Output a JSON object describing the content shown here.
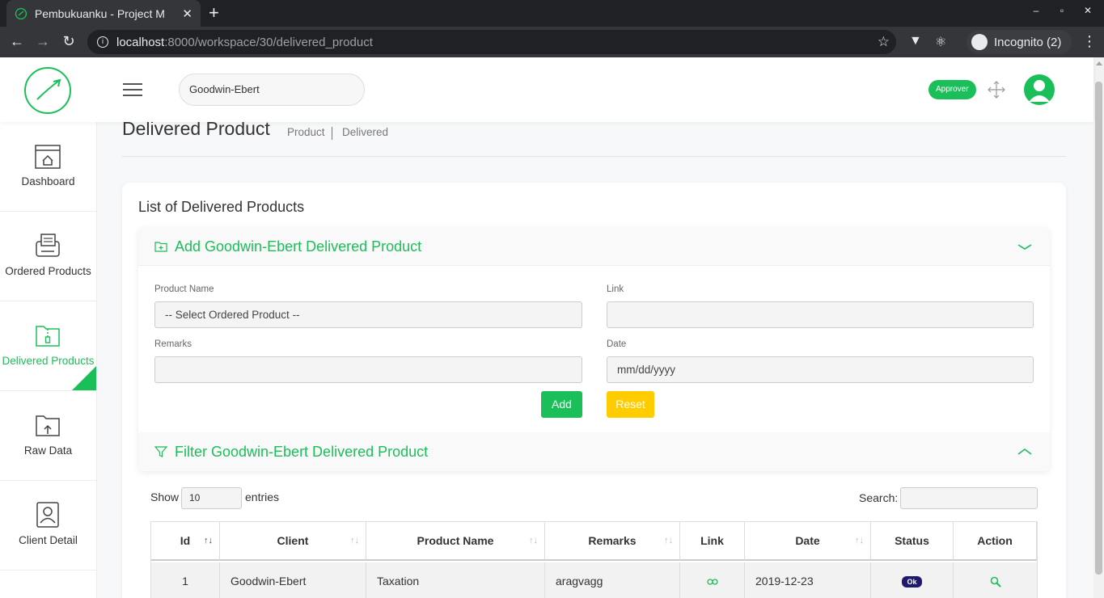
{
  "browser": {
    "tab_title": "Pembukuanku - Project M",
    "tab_close": "✕",
    "new_tab": "+",
    "url_host": "localhost",
    "url_rest": ":8000/workspace/30/delivered_product",
    "incognito_label": "Incognito (2)",
    "window_controls": [
      "‒",
      "▫",
      "✕"
    ]
  },
  "header": {
    "workspace_name": "Goodwin-Ebert",
    "role_badge": "Approver"
  },
  "sidebar": {
    "items": [
      {
        "label": "Dashboard",
        "icon": "dashboard-icon"
      },
      {
        "label": "Ordered Products",
        "icon": "printer-icon"
      },
      {
        "label": "Delivered Products",
        "icon": "zip-folder-icon",
        "active": true
      },
      {
        "label": "Raw Data",
        "icon": "folder-upload-icon"
      },
      {
        "label": "Client Detail",
        "icon": "contact-card-icon"
      }
    ]
  },
  "page": {
    "title": "Delivered Product",
    "breadcrumb_1": "Product",
    "breadcrumb_2": "Delivered",
    "card_title": "List of Delivered Products"
  },
  "add_form": {
    "title": "Add Goodwin-Ebert Delivered Product",
    "product_name_label": "Product Name",
    "product_name_value": "-- Select Ordered Product --",
    "link_label": "Link",
    "link_value": "",
    "remarks_label": "Remarks",
    "remarks_value": "",
    "date_label": "Date",
    "date_placeholder": "mm/dd/yyyy",
    "add_button": "Add",
    "reset_button": "Reset"
  },
  "filter": {
    "title": "Filter Goodwin-Ebert Delivered Product"
  },
  "table": {
    "show_label": "Show",
    "page_length": "10",
    "entries_label": "entries",
    "search_label": "Search:",
    "columns": [
      "Id",
      "Client",
      "Product Name",
      "Remarks",
      "Link",
      "Date",
      "Status",
      "Action"
    ],
    "rows": [
      {
        "id": "1",
        "client": "Goodwin-Ebert",
        "product_name": "Taxation",
        "remarks": "aragvagg",
        "link_icon": "link-icon",
        "date": "2019-12-23",
        "status": "Ok",
        "action_icon": "search-icon"
      }
    ]
  },
  "colors": {
    "brand_green": "#1bbf5a",
    "reset_yellow": "#ffcc00",
    "status_navy": "#1e1b6e"
  }
}
